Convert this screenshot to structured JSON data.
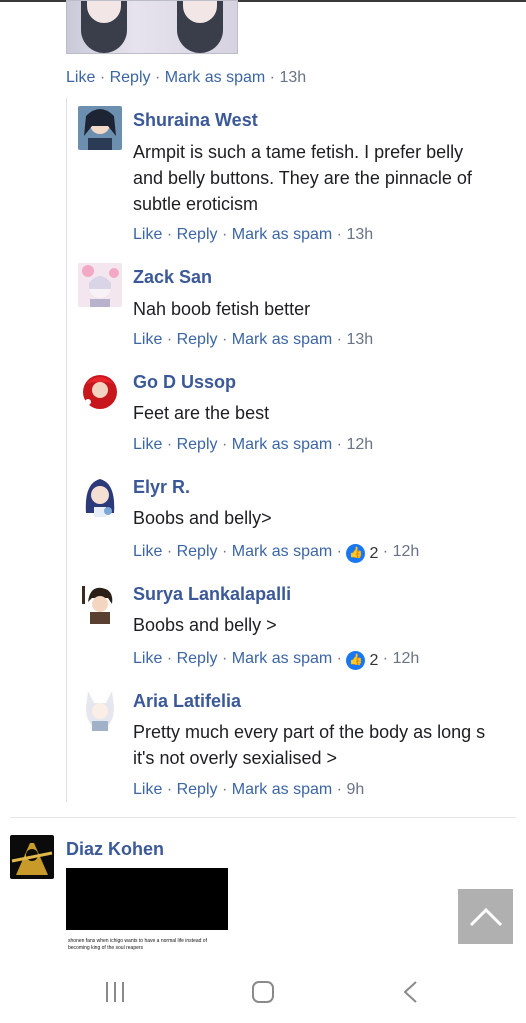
{
  "top_post": {
    "actions": {
      "like": "Like",
      "reply": "Reply",
      "spam": "Mark as spam",
      "time": "13h"
    }
  },
  "separator": "·",
  "replies": [
    {
      "name": "Shuraina West",
      "text_lines": [
        "Armpit is such a tame fetish. I prefer belly",
        "and belly buttons. They are the pinnacle of",
        "subtle eroticism"
      ],
      "like": "Like",
      "reply": "Reply",
      "spam": "Mark as spam",
      "time": "13h",
      "reactions": ""
    },
    {
      "name": "Zack San",
      "text_lines": [
        "Nah boob fetish better"
      ],
      "like": "Like",
      "reply": "Reply",
      "spam": "Mark as spam",
      "time": "13h",
      "reactions": ""
    },
    {
      "name": "Go D Ussop",
      "text_lines": [
        "Feet are the best"
      ],
      "like": "Like",
      "reply": "Reply",
      "spam": "Mark as spam",
      "time": "12h",
      "reactions": ""
    },
    {
      "name": "Elyr R.",
      "text_lines": [
        "Boobs and belly>"
      ],
      "like": "Like",
      "reply": "Reply",
      "spam": "Mark as spam",
      "time": "12h",
      "reactions": "2"
    },
    {
      "name": "Surya Lankalapalli",
      "text_lines": [
        "Boobs and belly >"
      ],
      "like": "Like",
      "reply": "Reply",
      "spam": "Mark as spam",
      "time": "12h",
      "reactions": "2"
    },
    {
      "name": "Aria Latifelia",
      "text_lines": [
        "Pretty much every part of the body as long s",
        "it's not overly sexialised >"
      ],
      "like": "Like",
      "reply": "Reply",
      "spam": "Mark as spam",
      "time": "9h",
      "reactions": ""
    }
  ],
  "next_comment": {
    "name": "Diaz Kohen",
    "image_caption": "shonen fans when ichigo wants to have a normal life instead of becoming king of the soul reapers"
  },
  "icons": {
    "scroll_up": "chevron-up-icon",
    "nav_recent": "recent-apps-icon",
    "nav_home": "home-icon",
    "nav_back": "back-icon"
  },
  "colors": {
    "link": "#3b65a5",
    "name": "#3b5998",
    "like_badge": "#1877f2"
  }
}
